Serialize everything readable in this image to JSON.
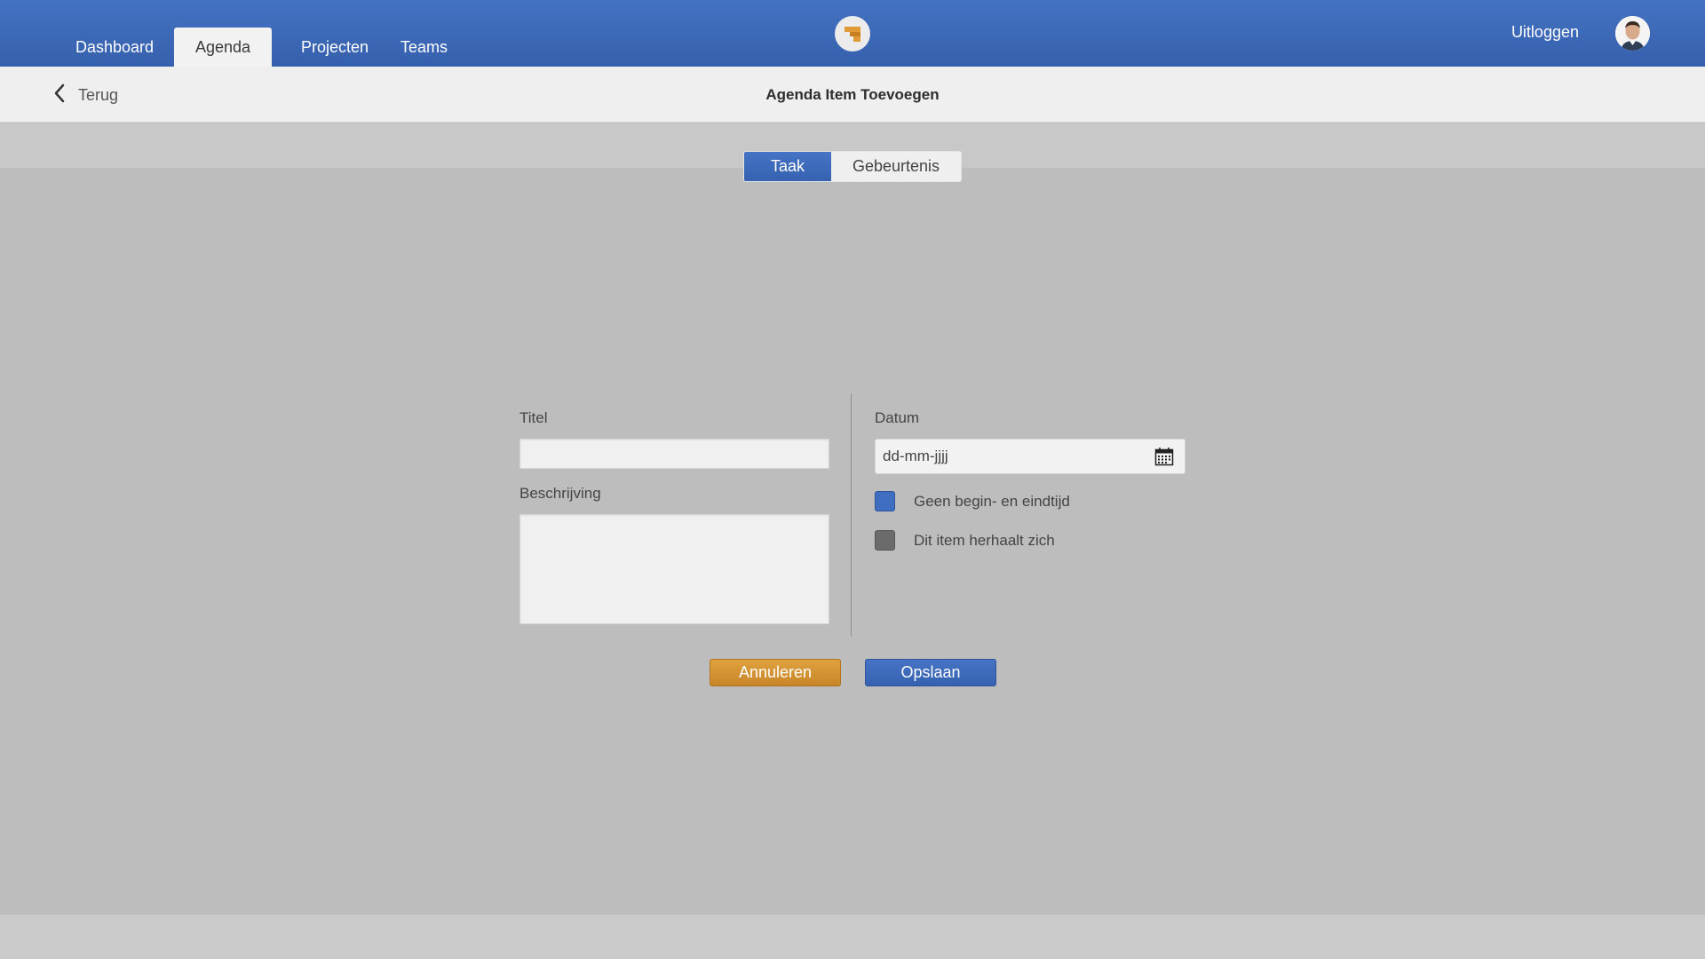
{
  "nav": {
    "tabs": [
      {
        "label": "Dashboard"
      },
      {
        "label": "Agenda",
        "active": true
      },
      {
        "label": "Projecten"
      },
      {
        "label": "Teams"
      }
    ],
    "logout_label": "Uitloggen",
    "brand_color": "#3d68b8",
    "logo_icon": "logo-icon",
    "avatar_icon": "avatar"
  },
  "subheader": {
    "back_label": "Terug",
    "title": "Agenda Item Toevoegen"
  },
  "segment": {
    "options": [
      {
        "label": "Taak",
        "selected": true
      },
      {
        "label": "Gebeurtenis",
        "selected": false
      }
    ]
  },
  "form": {
    "title_label": "Titel",
    "title_value": "",
    "description_label": "Beschrijving",
    "description_value": "",
    "date_label": "Datum",
    "date_placeholder": "dd-mm-jjjj",
    "no_time_label": "Geen begin- en eindtijd",
    "no_time_checked": true,
    "repeat_label": "Dit item herhaalt zich",
    "repeat_checked": false
  },
  "actions": {
    "cancel_label": "Annuleren",
    "save_label": "Opslaan",
    "cancel_color": "#d4942f",
    "save_color": "#3d68b8"
  }
}
